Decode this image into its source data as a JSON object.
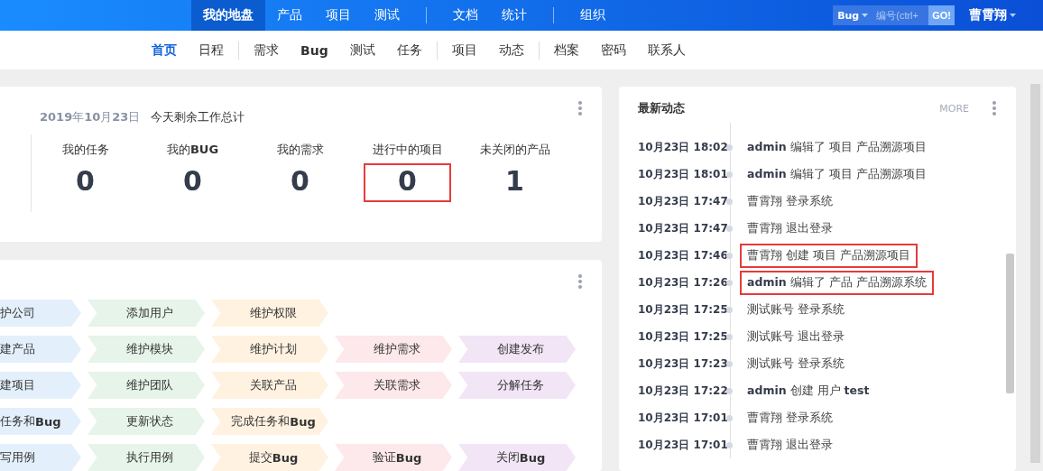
{
  "top_nav": {
    "groups": [
      [
        {
          "label": "我的地盘",
          "selected": true
        },
        {
          "label": "产品",
          "selected": false
        },
        {
          "label": "项目",
          "selected": false
        },
        {
          "label": "测试",
          "selected": false
        }
      ],
      [
        {
          "label": "文档",
          "selected": false
        },
        {
          "label": "统计",
          "selected": false
        }
      ],
      [
        {
          "label": "组织",
          "selected": false
        }
      ]
    ],
    "search": {
      "type": "Bug",
      "placeholder": "编号(ctrl+",
      "button": "GO!"
    },
    "user": "曹霄翔"
  },
  "sub_nav": {
    "groups": [
      [
        {
          "label": "首页",
          "selected": true
        },
        {
          "label": "日程",
          "selected": false
        }
      ],
      [
        {
          "label": "需求",
          "selected": false
        },
        {
          "label": "Bug",
          "selected": false
        },
        {
          "label": "测试",
          "selected": false
        },
        {
          "label": "任务",
          "selected": false
        }
      ],
      [
        {
          "label": "项目",
          "selected": false
        },
        {
          "label": "动态",
          "selected": false
        }
      ],
      [
        {
          "label": "档案",
          "selected": false
        },
        {
          "label": "密码",
          "selected": false
        },
        {
          "label": "联系人",
          "selected": false
        }
      ]
    ]
  },
  "summary": {
    "date": "**2019**年**10**月**23**日",
    "title": "今天剩余工作总计",
    "stats": [
      {
        "label": "我的任务",
        "value": "0",
        "highlighted": false
      },
      {
        "label": "我的**BUG**",
        "value": "0",
        "highlighted": false
      },
      {
        "label": "我的需求",
        "value": "0",
        "highlighted": false
      },
      {
        "label": "进行中的项目",
        "value": "0",
        "highlighted": true
      },
      {
        "label": "未关闭的产品",
        "value": "1",
        "highlighted": false
      }
    ]
  },
  "flow": {
    "columns": [
      {
        "color": "#e3f0fc"
      },
      {
        "color": "#e6f4e9"
      },
      {
        "color": "#fff2e0"
      },
      {
        "color": "#fde8eb"
      },
      {
        "color": "#f1e5f6"
      }
    ],
    "rows": [
      [
        "护公司",
        "添加用户",
        "维护权限"
      ],
      [
        "建产品",
        "维护模块",
        "维护计划",
        "维护需求",
        "创建发布"
      ],
      [
        "建项目",
        "维护团队",
        "关联产品",
        "关联需求",
        "分解任务"
      ],
      [
        "任务和**Bug**",
        "更新状态",
        "完成任务和**Bug**"
      ],
      [
        "写用例",
        "执行用例",
        "提交**Bug**",
        "验证**Bug**",
        "关闭**Bug**"
      ]
    ]
  },
  "activity": {
    "title": "最新动态",
    "more": "MORE",
    "entries": [
      {
        "time": "10月23日 18:02",
        "text": "**admin** 编辑了 项目 产品溯源项目",
        "highlighted": false
      },
      {
        "time": "10月23日 18:01",
        "text": "**admin** 编辑了 项目 产品溯源项目",
        "highlighted": false
      },
      {
        "time": "10月23日 17:47",
        "text": "曹霄翔 登录系统",
        "highlighted": false
      },
      {
        "time": "10月23日 17:47",
        "text": "曹霄翔 退出登录",
        "highlighted": false
      },
      {
        "time": "10月23日 17:46",
        "text": "曹霄翔 创建 项目 产品溯源项目",
        "highlighted": true
      },
      {
        "time": "10月23日 17:26",
        "text": "**admin** 编辑了 产品 产品溯源系统",
        "highlighted": true
      },
      {
        "time": "10月23日 17:25",
        "text": "测试账号 登录系统",
        "highlighted": false
      },
      {
        "time": "10月23日 17:25",
        "text": "测试账号 退出登录",
        "highlighted": false
      },
      {
        "time": "10月23日 17:23",
        "text": "测试账号 登录系统",
        "highlighted": false
      },
      {
        "time": "10月23日 17:22",
        "text": "**admin** 创建 用户 **test**",
        "highlighted": false
      },
      {
        "time": "10月23日 17:01",
        "text": "曹霄翔 登录系统",
        "highlighted": false
      },
      {
        "time": "10月23日 17:01",
        "text": "曹霄翔 退出登录",
        "highlighted": false
      }
    ]
  }
}
